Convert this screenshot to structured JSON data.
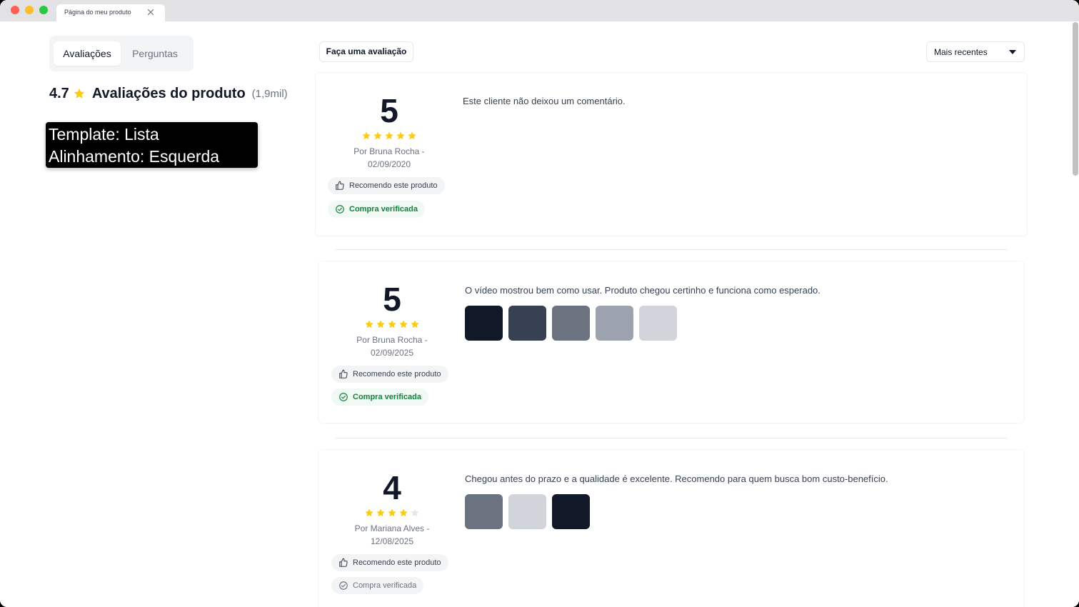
{
  "browser": {
    "tab_title": "Página do meu produto",
    "colors": {
      "close": "#ff5f57",
      "minimize": "#febc2e",
      "maximize": "#28c840"
    }
  },
  "tabs": [
    {
      "label": "Avaliações",
      "active": true
    },
    {
      "label": "Perguntas",
      "active": false
    }
  ],
  "summary": {
    "average": "4.7",
    "title": "Avaliações do produto",
    "count": "(1,9mil)"
  },
  "overlay": {
    "line1": "Template: Lista",
    "line2": "Alinhamento: Esquerda"
  },
  "actions": {
    "write_review": "Faça uma avaliação",
    "sort_selected": "Mais recentes"
  },
  "reviews": [
    {
      "score": "5",
      "stars": 5,
      "author_line1": "Por Bruna Rocha -",
      "author_line2": "02/09/2020",
      "recommend": "Recomendo este produto",
      "verified": "Compra verificada",
      "comment": "Este cliente não deixou um comentário.",
      "thumbnails": []
    },
    {
      "score": "5",
      "stars": 5,
      "author_line1": "Por Bruna Rocha -",
      "author_line2": "02/09/2025",
      "recommend": "Recomendo este produto",
      "verified": "Compra verificada",
      "comment": "O vídeo mostrou bem como usar. Produto chegou certinho e funciona como esperado.",
      "thumbnails": [
        "#111827",
        "#374151",
        "#6b7280",
        "#9ca3af",
        "#d1d5db"
      ]
    },
    {
      "score": "4",
      "stars": 4,
      "author_line1": "Por Mariana Alves -",
      "author_line2": "12/08/2025",
      "recommend": "Recomendo este produto",
      "verified": "Compra verificada",
      "comment": "Chegou antes do prazo e a qualidade é excelente. Recomendo para quem busca bom custo-benefício.",
      "thumbnails": [
        "#6b7280",
        "#d1d5db",
        "#111827"
      ]
    }
  ],
  "colors": {
    "star_filled": "#facc15",
    "star_empty": "#e5e7eb",
    "verified_green": "#15803d"
  }
}
